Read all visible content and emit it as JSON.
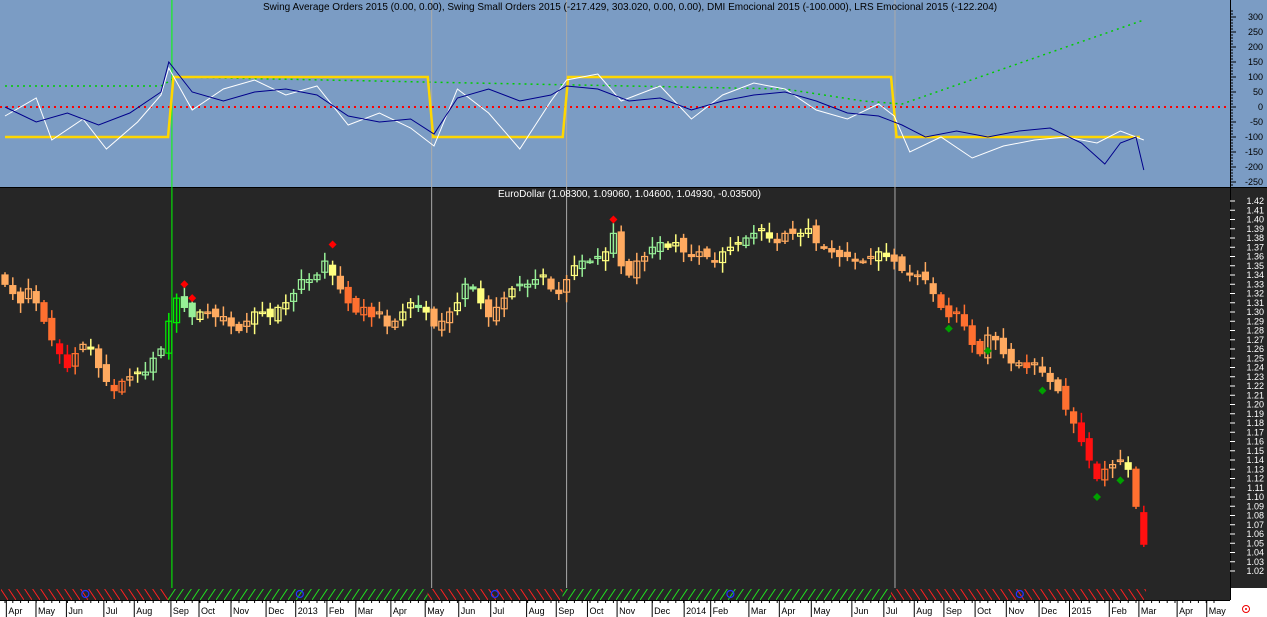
{
  "indicator_panel": {
    "title": "Swing Average Orders 2015 (0.00, 0.00), Swing Small Orders 2015 (-217.429, 303.020, 0.00, 0.00), DMI Emocional 2015 (-100.000), LRS Emocional 2015 (-122.204)",
    "y_ticks": [
      "300",
      "250",
      "200",
      "150",
      "100",
      "50",
      "0",
      "-50",
      "-100",
      "-150",
      "-200",
      "-250"
    ],
    "colors": {
      "bg": "#7b9cc4",
      "blue": "#00008b",
      "white": "#ffffff",
      "yellow": "#ffd700",
      "green": "#00cc00",
      "red": "#ff0000"
    }
  },
  "price_panel": {
    "title": "EuroDollar (1.08300, 1.09060, 1.04600, 1.04930, -0.03500)",
    "y_ticks": [
      "1.42",
      "1.41",
      "1.40",
      "1.39",
      "1.38",
      "1.37",
      "1.36",
      "1.35",
      "1.34",
      "1.33",
      "1.32",
      "1.31",
      "1.30",
      "1.29",
      "1.28",
      "1.27",
      "1.26",
      "1.25",
      "1.24",
      "1.23",
      "1.22",
      "1.21",
      "1.20",
      "1.19",
      "1.18",
      "1.17",
      "1.16",
      "1.15",
      "1.14",
      "1.13",
      "1.12",
      "1.11",
      "1.10",
      "1.09",
      "1.08",
      "1.07",
      "1.06",
      "1.05",
      "1.04",
      "1.03",
      "1.02"
    ]
  },
  "chart_data": {
    "type": "candlestick",
    "symbol": "EuroDollar",
    "period": "weekly",
    "ylim": [
      1.015,
      1.425
    ],
    "closes": [
      1.33,
      1.32,
      1.31,
      1.325,
      1.31,
      1.29,
      1.27,
      1.255,
      1.24,
      1.255,
      1.265,
      1.26,
      1.24,
      1.225,
      1.215,
      1.225,
      1.23,
      1.235,
      1.235,
      1.25,
      1.26,
      1.29,
      1.315,
      1.305,
      1.295,
      1.3,
      1.3,
      1.295,
      1.295,
      1.285,
      1.28,
      1.29,
      1.3,
      1.3,
      1.295,
      1.305,
      1.31,
      1.32,
      1.335,
      1.335,
      1.34,
      1.355,
      1.34,
      1.325,
      1.31,
      1.3,
      1.305,
      1.295,
      1.3,
      1.285,
      1.29,
      1.3,
      1.31,
      1.305,
      1.3,
      1.285,
      1.29,
      1.3,
      1.31,
      1.33,
      1.325,
      1.31,
      1.295,
      1.305,
      1.315,
      1.325,
      1.33,
      1.33,
      1.335,
      1.34,
      1.325,
      1.32,
      1.335,
      1.35,
      1.355,
      1.355,
      1.36,
      1.365,
      1.385,
      1.35,
      1.34,
      1.355,
      1.36,
      1.37,
      1.375,
      1.37,
      1.375,
      1.365,
      1.36,
      1.365,
      1.36,
      1.355,
      1.365,
      1.37,
      1.375,
      1.38,
      1.385,
      1.39,
      1.38,
      1.375,
      1.385,
      1.385,
      1.385,
      1.39,
      1.375,
      1.37,
      1.365,
      1.36,
      1.36,
      1.355,
      1.355,
      1.36,
      1.365,
      1.36,
      1.355,
      1.345,
      1.34,
      1.34,
      1.335,
      1.32,
      1.305,
      1.295,
      1.3,
      1.285,
      1.265,
      1.255,
      1.275,
      1.27,
      1.255,
      1.245,
      1.245,
      1.24,
      1.245,
      1.235,
      1.225,
      1.215,
      1.195,
      1.18,
      1.16,
      1.14,
      1.12,
      1.13,
      1.135,
      1.14,
      1.13,
      1.09,
      1.049
    ],
    "last_bar": {
      "open": 1.083,
      "high": 1.0906,
      "low": 1.046,
      "close": 1.0493,
      "change": -0.035
    },
    "markers": [
      {
        "bar": 23,
        "price": 1.33,
        "color": "#ff0000"
      },
      {
        "bar": 24,
        "price": 1.315,
        "color": "#ff0000"
      },
      {
        "bar": 42,
        "price": 1.373,
        "color": "#ff0000"
      },
      {
        "bar": 78,
        "price": 1.4,
        "color": "#ff0000"
      },
      {
        "bar": 121,
        "price": 1.282,
        "color": "#00a000"
      },
      {
        "bar": 126,
        "price": 1.258,
        "color": "#00a000"
      },
      {
        "bar": 133,
        "price": 1.215,
        "color": "#00a000"
      },
      {
        "bar": 140,
        "price": 1.1,
        "color": "#00a000"
      },
      {
        "bar": 143,
        "price": 1.118,
        "color": "#00a000"
      }
    ],
    "signal_lines": [
      {
        "bar": 21.4,
        "color": "#00ff00"
      },
      {
        "bar": 54.7,
        "color": "#aaaaaa"
      },
      {
        "bar": 72,
        "color": "#aaaaaa"
      },
      {
        "bar": 114.1,
        "color": "#aaaaaa"
      }
    ],
    "regimes": [
      {
        "from": 0,
        "to": 21.4,
        "state": "short"
      },
      {
        "from": 21.4,
        "to": 54.7,
        "state": "long"
      },
      {
        "from": 54.7,
        "to": 72,
        "state": "short"
      },
      {
        "from": 72,
        "to": 114.1,
        "state": "long"
      },
      {
        "from": 114.1,
        "to": 146.8,
        "state": "short"
      }
    ],
    "band_circles": [
      10.3,
      37.8,
      62.8,
      93,
      130.1
    ],
    "indicator": {
      "ylim": [
        -270,
        330
      ],
      "dmi_step": [
        {
          "from": 0,
          "to": 21.4,
          "value": -100
        },
        {
          "from": 21.4,
          "to": 54.7,
          "value": 100
        },
        {
          "from": 54.7,
          "to": 72,
          "value": -100
        },
        {
          "from": 72,
          "to": 114.1,
          "value": 100
        },
        {
          "from": 114.1,
          "to": 146,
          "value": -100
        }
      ],
      "blue": [
        [
          0,
          0
        ],
        [
          4,
          -50
        ],
        [
          8,
          -20
        ],
        [
          12,
          -60
        ],
        [
          16,
          -20
        ],
        [
          20,
          50
        ],
        [
          21,
          150
        ],
        [
          24,
          50
        ],
        [
          28,
          20
        ],
        [
          32,
          50
        ],
        [
          36,
          60
        ],
        [
          40,
          40
        ],
        [
          44,
          -30
        ],
        [
          48,
          -50
        ],
        [
          52,
          -40
        ],
        [
          55,
          -90
        ],
        [
          58,
          30
        ],
        [
          62,
          60
        ],
        [
          66,
          20
        ],
        [
          70,
          40
        ],
        [
          72,
          70
        ],
        [
          76,
          60
        ],
        [
          80,
          20
        ],
        [
          84,
          30
        ],
        [
          88,
          -10
        ],
        [
          92,
          20
        ],
        [
          96,
          40
        ],
        [
          100,
          50
        ],
        [
          104,
          20
        ],
        [
          108,
          -20
        ],
        [
          112,
          -30
        ],
        [
          115,
          -60
        ],
        [
          118,
          -100
        ],
        [
          122,
          -80
        ],
        [
          126,
          -100
        ],
        [
          130,
          -80
        ],
        [
          134,
          -70
        ],
        [
          138,
          -120
        ],
        [
          141,
          -190
        ],
        [
          143,
          -120
        ],
        [
          145,
          -100
        ],
        [
          146,
          -210
        ]
      ],
      "white": [
        [
          0,
          -30
        ],
        [
          4,
          30
        ],
        [
          6,
          -110
        ],
        [
          10,
          -40
        ],
        [
          13,
          -140
        ],
        [
          17,
          -50
        ],
        [
          20,
          40
        ],
        [
          21,
          130
        ],
        [
          24,
          -10
        ],
        [
          28,
          60
        ],
        [
          32,
          90
        ],
        [
          36,
          40
        ],
        [
          40,
          70
        ],
        [
          44,
          -60
        ],
        [
          48,
          -20
        ],
        [
          52,
          -70
        ],
        [
          55,
          -130
        ],
        [
          58,
          60
        ],
        [
          62,
          -20
        ],
        [
          66,
          -140
        ],
        [
          70,
          20
        ],
        [
          72,
          90
        ],
        [
          76,
          110
        ],
        [
          79,
          20
        ],
        [
          84,
          70
        ],
        [
          88,
          -40
        ],
        [
          92,
          40
        ],
        [
          96,
          80
        ],
        [
          100,
          60
        ],
        [
          104,
          -10
        ],
        [
          108,
          -40
        ],
        [
          112,
          10
        ],
        [
          114,
          -30
        ],
        [
          116,
          -150
        ],
        [
          120,
          -100
        ],
        [
          124,
          -170
        ],
        [
          128,
          -130
        ],
        [
          132,
          -110
        ],
        [
          136,
          -100
        ],
        [
          140,
          -120
        ],
        [
          143,
          -80
        ],
        [
          146,
          -110
        ]
      ],
      "green": [
        [
          0,
          70
        ],
        [
          20,
          70
        ],
        [
          22,
          100
        ],
        [
          60,
          80
        ],
        [
          100,
          60
        ],
        [
          110,
          20
        ],
        [
          115,
          10
        ],
        [
          146,
          290
        ]
      ]
    },
    "x_labels": [
      {
        "bar": 0.3,
        "label": "Apr"
      },
      {
        "bar": 4.1,
        "label": "May"
      },
      {
        "bar": 8,
        "label": "Jun"
      },
      {
        "bar": 12.8,
        "label": "Jul"
      },
      {
        "bar": 16.7,
        "label": "Aug"
      },
      {
        "bar": 21.4,
        "label": "Sep"
      },
      {
        "bar": 25,
        "label": "Oct"
      },
      {
        "bar": 29.1,
        "label": "Nov"
      },
      {
        "bar": 33.6,
        "label": "Dec"
      },
      {
        "bar": 37.4,
        "label": "2013"
      },
      {
        "bar": 41.4,
        "label": "Feb"
      },
      {
        "bar": 45.1,
        "label": "Mar"
      },
      {
        "bar": 49.6,
        "label": "Apr"
      },
      {
        "bar": 54,
        "label": "May"
      },
      {
        "bar": 58.3,
        "label": "Jun"
      },
      {
        "bar": 62.4,
        "label": "Jul"
      },
      {
        "bar": 67,
        "label": "Aug"
      },
      {
        "bar": 70.8,
        "label": "Sep"
      },
      {
        "bar": 74.8,
        "label": "Oct"
      },
      {
        "bar": 78.6,
        "label": "Nov"
      },
      {
        "bar": 83.1,
        "label": "Dec"
      },
      {
        "bar": 87.2,
        "label": "2014"
      },
      {
        "bar": 90.6,
        "label": "Feb"
      },
      {
        "bar": 95.5,
        "label": "Mar"
      },
      {
        "bar": 99.4,
        "label": "Apr"
      },
      {
        "bar": 103.5,
        "label": "May"
      },
      {
        "bar": 108.7,
        "label": "Jun"
      },
      {
        "bar": 112.8,
        "label": "Jul"
      },
      {
        "bar": 116.7,
        "label": "Aug"
      },
      {
        "bar": 120.5,
        "label": "Sep"
      },
      {
        "bar": 124.5,
        "label": "Oct"
      },
      {
        "bar": 128.5,
        "label": "Nov"
      },
      {
        "bar": 132.7,
        "label": "Dec"
      },
      {
        "bar": 136.6,
        "label": "2015"
      },
      {
        "bar": 141.7,
        "label": "Feb"
      },
      {
        "bar": 145.5,
        "label": "Mar"
      },
      {
        "bar": 150.4,
        "label": "Apr"
      },
      {
        "bar": 154.2,
        "label": "May"
      }
    ]
  }
}
